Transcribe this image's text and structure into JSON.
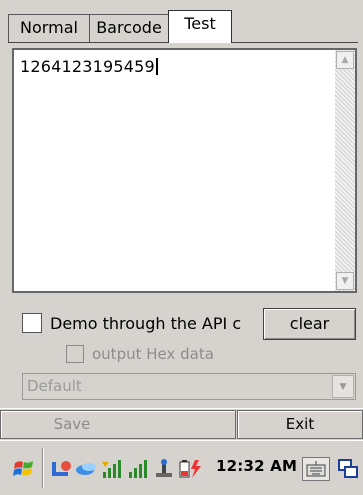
{
  "tabs": [
    {
      "label": "Normal",
      "active": false
    },
    {
      "label": "Barcode",
      "active": false
    },
    {
      "label": "Test",
      "active": true
    }
  ],
  "output": {
    "text": "1264123195459"
  },
  "demo_checkbox": {
    "label": "Demo through the API c",
    "checked": false
  },
  "clear_button": {
    "label": "clear"
  },
  "hex_checkbox": {
    "label": "output Hex data",
    "checked": false,
    "enabled": false
  },
  "mode_select": {
    "value": "Default",
    "enabled": false
  },
  "menu": {
    "save": "Save",
    "exit": "Exit"
  },
  "taskbar": {
    "time": "12:32 AM",
    "icons": [
      "start-icon",
      "usb-sync-icon",
      "network-icon",
      "signal-strength-icon",
      "signal-bars-icon",
      "connection-icon",
      "battery-charging-icon",
      "keyboard-icon",
      "switch-windows-icon"
    ]
  },
  "colors": {
    "background": "#d6d3ce",
    "disabled_text": "#8d8d8d"
  }
}
